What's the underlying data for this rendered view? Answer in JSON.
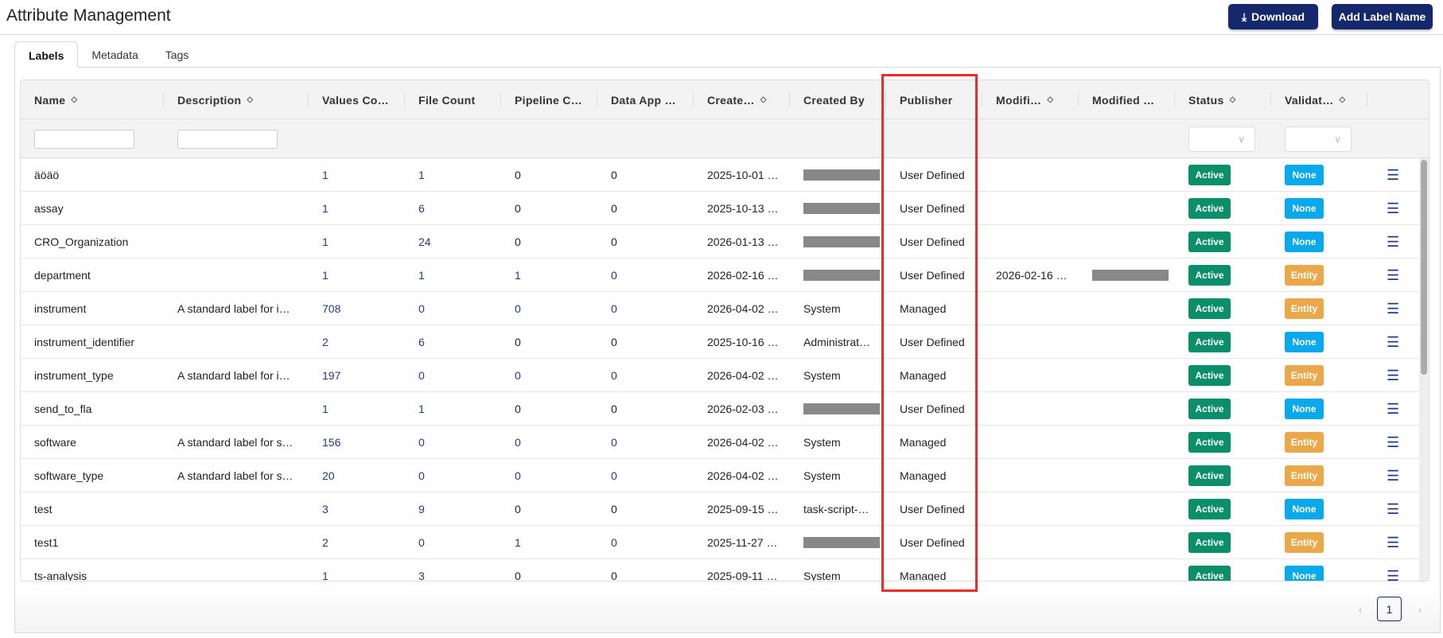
{
  "header": {
    "title": "Attribute Management",
    "download_label": "Download",
    "add_label": "Add Label Name"
  },
  "tabs": [
    {
      "label": "Labels",
      "active": true
    },
    {
      "label": "Metadata"
    },
    {
      "label": "Tags"
    }
  ],
  "columns": [
    {
      "label": "Name",
      "sort": true
    },
    {
      "label": "Description",
      "sort": true
    },
    {
      "label": "Values Co…"
    },
    {
      "label": "File Count"
    },
    {
      "label": "Pipeline C…"
    },
    {
      "label": "Data App …"
    },
    {
      "label": "Create…",
      "sort": true
    },
    {
      "label": "Created By"
    },
    {
      "label": "Publisher"
    },
    {
      "label": "Modifi…",
      "sort": true
    },
    {
      "label": "Modified …"
    },
    {
      "label": "Status",
      "sort": true
    },
    {
      "label": "Validat…",
      "sort": true
    }
  ],
  "colors": {
    "navy": "#14286b",
    "active": "#0a8f6a",
    "none": "#0aa9ec",
    "entity": "#eaa84b",
    "highlight": "#ee2a24"
  },
  "rows": [
    {
      "name": "äöäö",
      "desc": "",
      "values": "1",
      "files": "1",
      "pipeline": "0",
      "pl": false,
      "dataapp": "0",
      "dl": false,
      "created": "2025-10-01 …",
      "created_by": "",
      "publisher": "User Defined",
      "modified": "",
      "modified_by": "",
      "status": "Active",
      "validation": "None"
    },
    {
      "name": "assay",
      "desc": "",
      "values": "1",
      "files": "6",
      "pipeline": "0",
      "pl": false,
      "dataapp": "0",
      "dl": false,
      "created": "2025-10-13 …",
      "created_by": "",
      "publisher": "User Defined",
      "modified": "",
      "modified_by": "",
      "status": "Active",
      "validation": "None"
    },
    {
      "name": "CRO_Organization",
      "desc": "",
      "values": "1",
      "files": "24",
      "pipeline": "0",
      "pl": false,
      "dataapp": "0",
      "dl": false,
      "created": "2026-01-13 …",
      "created_by": "",
      "publisher": "User Defined",
      "modified": "",
      "modified_by": "",
      "status": "Active",
      "validation": "None"
    },
    {
      "name": "department",
      "desc": "",
      "values": "1",
      "files": "1",
      "pipeline": "1",
      "pl": true,
      "dataapp": "0",
      "dl": true,
      "created": "2026-02-16 …",
      "created_by": "",
      "publisher": "User Defined",
      "modified": "2026-02-16 …",
      "modified_by": "",
      "mod_redacted": true,
      "status": "Active",
      "validation": "Entity"
    },
    {
      "name": "instrument",
      "desc": "A standard label for i…",
      "values": "708",
      "files": "0",
      "pipeline": "0",
      "pl": true,
      "dataapp": "0",
      "dl": true,
      "created": "2026-04-02 …",
      "created_by": "System",
      "publisher": "Managed",
      "modified": "",
      "modified_by": "",
      "status": "Active",
      "validation": "Entity"
    },
    {
      "name": "instrument_identifier",
      "desc": "",
      "values": "2",
      "files": "6",
      "pipeline": "0",
      "pl": false,
      "dataapp": "0",
      "dl": false,
      "created": "2025-10-16 …",
      "created_by": "Administrat…",
      "publisher": "User Defined",
      "modified": "",
      "modified_by": "",
      "status": "Active",
      "validation": "None"
    },
    {
      "name": "instrument_type",
      "desc": "A standard label for i…",
      "values": "197",
      "files": "0",
      "pipeline": "0",
      "pl": true,
      "dataapp": "0",
      "dl": true,
      "created": "2026-04-02 …",
      "created_by": "System",
      "publisher": "Managed",
      "modified": "",
      "modified_by": "",
      "status": "Active",
      "validation": "Entity"
    },
    {
      "name": "send_to_fla",
      "desc": "",
      "values": "1",
      "files": "1",
      "pipeline": "0",
      "pl": false,
      "dataapp": "0",
      "dl": false,
      "created": "2026-02-03 …",
      "created_by": "",
      "publisher": "User Defined",
      "modified": "",
      "modified_by": "",
      "status": "Active",
      "validation": "None"
    },
    {
      "name": "software",
      "desc": "A standard label for s…",
      "values": "156",
      "files": "0",
      "pipeline": "0",
      "pl": true,
      "dataapp": "0",
      "dl": true,
      "created": "2026-04-02 …",
      "created_by": "System",
      "publisher": "Managed",
      "modified": "",
      "modified_by": "",
      "status": "Active",
      "validation": "Entity"
    },
    {
      "name": "software_type",
      "desc": "A standard label for s…",
      "values": "20",
      "files": "0",
      "pipeline": "0",
      "pl": true,
      "dataapp": "0",
      "dl": true,
      "created": "2026-04-02 …",
      "created_by": "System",
      "publisher": "Managed",
      "modified": "",
      "modified_by": "",
      "status": "Active",
      "validation": "Entity"
    },
    {
      "name": "test",
      "desc": "",
      "values": "3",
      "files": "9",
      "pipeline": "0",
      "pl": false,
      "dataapp": "0",
      "dl": false,
      "created": "2025-09-15 …",
      "created_by": "task-script-…",
      "publisher": "User Defined",
      "modified": "",
      "modified_by": "",
      "status": "Active",
      "validation": "None"
    },
    {
      "name": "test1",
      "desc": "",
      "values": "2",
      "files": "0",
      "pipeline": "1",
      "pl": true,
      "dataapp": "0",
      "dl": true,
      "created": "2025-11-27 …",
      "created_by": "",
      "publisher": "User Defined",
      "modified": "",
      "modified_by": "",
      "status": "Active",
      "validation": "Entity"
    },
    {
      "name": "ts-analysis",
      "desc": "",
      "values": "1",
      "files": "3",
      "pipeline": "0",
      "pl": false,
      "dataapp": "0",
      "dl": false,
      "created": "2025-09-11 …",
      "created_by": "System",
      "publisher": "Managed",
      "modified": "",
      "modified_by": "",
      "status": "Active",
      "validation": "None"
    }
  ],
  "pagination": {
    "current": "1",
    "prev": "‹",
    "next": "›"
  }
}
